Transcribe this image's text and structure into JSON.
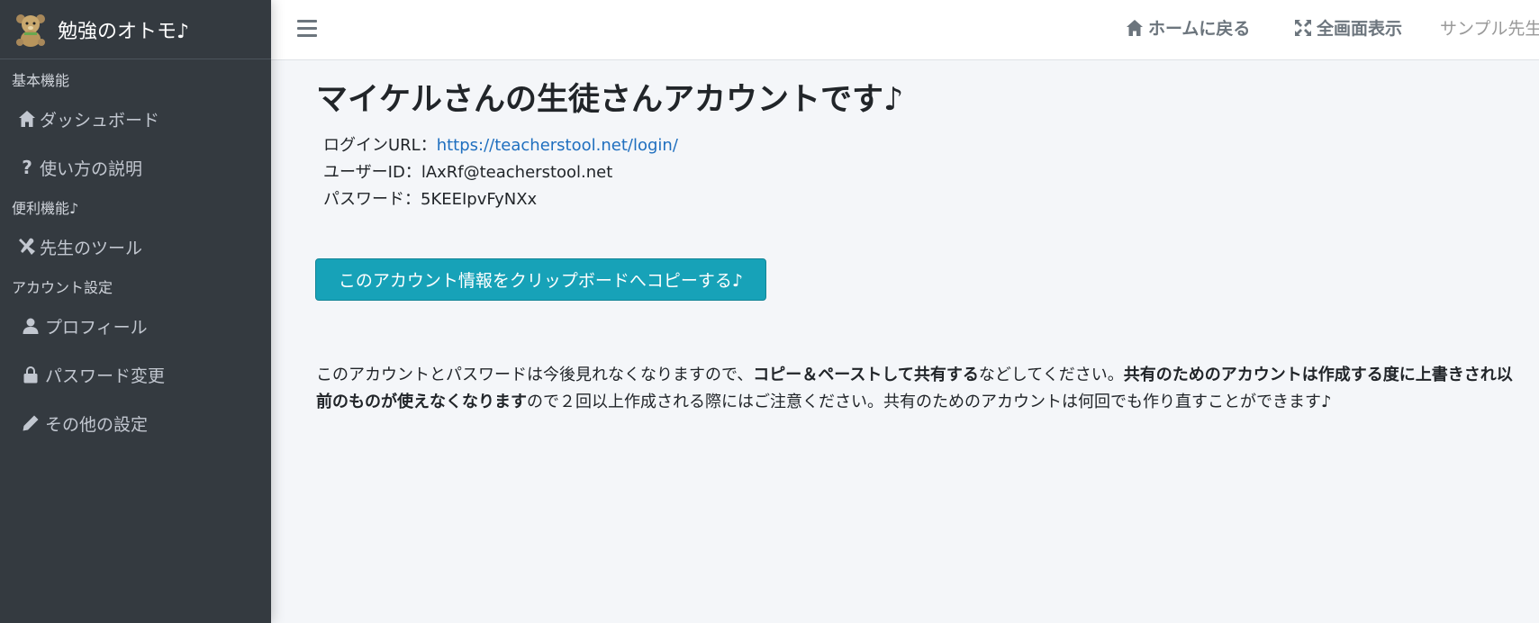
{
  "brand": {
    "title": "勉強のオトモ♪"
  },
  "sidebar": {
    "sections": [
      {
        "header": "基本機能",
        "items": [
          {
            "label": "ダッシュボード",
            "icon": "home-icon"
          },
          {
            "label": "使い方の説明",
            "icon": "question-icon"
          }
        ]
      },
      {
        "header": "便利機能♪",
        "items": [
          {
            "label": "先生のツール",
            "icon": "tools-icon"
          }
        ]
      },
      {
        "header": "アカウント設定",
        "items": [
          {
            "label": "プロフィール",
            "icon": "user-icon"
          },
          {
            "label": "パスワード変更",
            "icon": "lock-icon"
          },
          {
            "label": "その他の設定",
            "icon": "pencil-icon"
          }
        ]
      }
    ]
  },
  "topbar": {
    "home_label": "ホームに戻る",
    "fullscreen_label": "全画面表示",
    "user_label": "サンプル先生"
  },
  "main": {
    "title_prefix": "マイケルさんの",
    "title_bold": "生徒さんアカウント",
    "title_suffix": "です♪",
    "login_url_label": "ログインURL：",
    "login_url": "https://teacherstool.net/login/",
    "user_id_label": "ユーザーID：",
    "user_id": "lAxRf@teacherstool.net",
    "password_label": "パスワード：",
    "password": "5KEEIpvFyNXx",
    "copy_button": "このアカウント情報をクリップボードへコピーする♪",
    "notice_1": "このアカウントとパスワードは今後見れなくなりますので、",
    "notice_2_bold": "コピー＆ペーストして共有する",
    "notice_3": "などしてください。",
    "notice_4_bold": "共有のためのアカウントは作成する度に上書きされ以前のものが使えなくなります",
    "notice_5": "ので２回以上作成される際にはご注意ください。共有のためのアカウントは何回でも作り直すことができます♪"
  },
  "colors": {
    "sidebar_bg": "#343a40",
    "accent": "#17a2b8",
    "link": "#1f6fbf"
  }
}
